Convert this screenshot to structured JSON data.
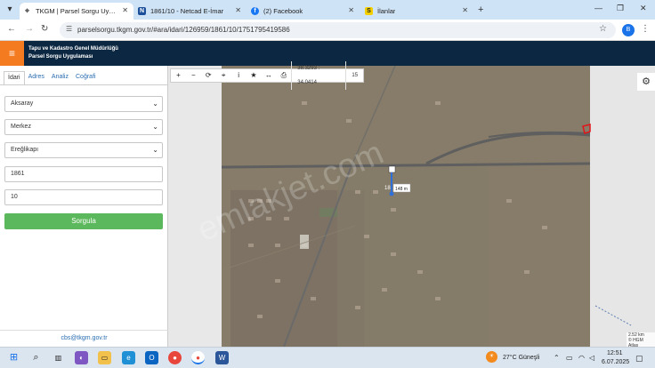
{
  "browser": {
    "tabs": [
      {
        "title": "TKGM | Parsel Sorgu Uygulama",
        "active": true,
        "icon": "map-pin-icon",
        "color": "#555555"
      },
      {
        "title": "1861/10 - Netcad E-İmar",
        "active": false,
        "icon": "netcad-icon",
        "color": "#1c4f9a"
      },
      {
        "title": "(2) Facebook",
        "active": false,
        "icon": "facebook-icon",
        "color": "#1877f2"
      },
      {
        "title": "İlanlar",
        "active": false,
        "icon": "sahibinden-icon",
        "color": "#f5d000"
      }
    ],
    "url": "parselsorgu.tkgm.gov.tr/#ara/idari/126959/1861/10/1751795419586",
    "profile_initial": "B"
  },
  "site": {
    "title_line1": "Tapu ve Kadastro Genel Müdürlüğü",
    "title_line2": "Parsel Sorgu Uygulaması",
    "accent": "#f47b20",
    "header_bg": "#0c2741"
  },
  "sidebar": {
    "tabs": [
      "İdari",
      "Adres",
      "Analiz",
      "Coğrafi"
    ],
    "il": "Aksaray",
    "ilce": "Merkez",
    "mahalle": "Ereğlikapı",
    "ada": "1861",
    "parsel": "10",
    "button_label": "Sorgula",
    "button_color": "#5cb85c",
    "email": "cbs@tkgm.gov.tr"
  },
  "map": {
    "coordinates": "38.3293 : 34.0414",
    "zoom": "15",
    "measure_label": "148 m",
    "parcel_marker": "18",
    "watermark": "emlakjet.com",
    "scale_km": "2.52 km",
    "attribution": "© HGM Atlas"
  },
  "taskbar": {
    "weather": "27°C Güneşli",
    "time": "12:51",
    "date": "6.07.2025"
  }
}
